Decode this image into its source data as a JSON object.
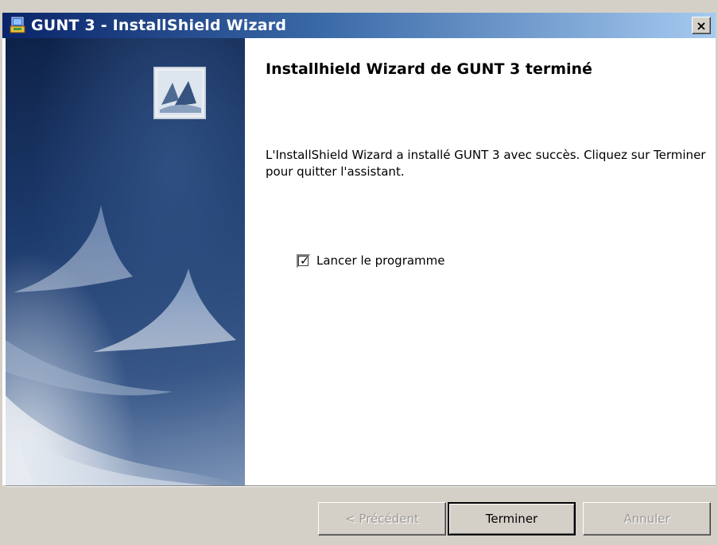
{
  "window": {
    "title": "GUNT 3 - InstallShield Wizard",
    "close_label": "×"
  },
  "main": {
    "heading": "Installhield Wizard de GUNT 3 terminé",
    "description": "L'InstallShield Wizard a installé GUNT 3 avec succès. Cliquez sur Terminer pour quitter l'assistant.",
    "launch_checkbox": {
      "label": "Lancer le programme",
      "checked": true
    }
  },
  "buttons": {
    "previous": "< Précédent",
    "finish": "Terminer",
    "cancel": "Annuler"
  },
  "colors": {
    "titlebar_start": "#0a246a",
    "titlebar_end": "#a6caf0",
    "dialog_bg": "#d4d0c8",
    "side_panel": "#1c3a6c"
  },
  "icons": {
    "app": "installer-computer-icon",
    "logo": "installshield-sail-logo"
  }
}
